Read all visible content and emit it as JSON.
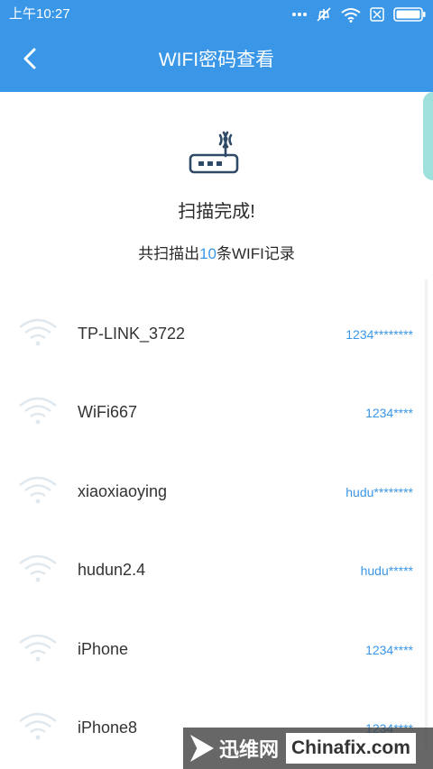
{
  "statusbar": {
    "time": "上午10:27",
    "icons": [
      "more-icon",
      "mute-icon",
      "wifi-signal-icon",
      "sim-icon",
      "battery-icon"
    ]
  },
  "header": {
    "title": "WIFI密码查看",
    "back_icon": "chevron-left-icon"
  },
  "scan": {
    "status": "扫描完成!",
    "summary_prefix": "共扫描出",
    "count": "10",
    "summary_suffix": "条WIFI记录"
  },
  "wifi_list": [
    {
      "ssid": "TP-LINK_3722",
      "password": "1234********"
    },
    {
      "ssid": "WiFi667",
      "password": "1234****"
    },
    {
      "ssid": "xiaoxiaoying",
      "password": "hudu********"
    },
    {
      "ssid": "hudun2.4",
      "password": "hudu*****"
    },
    {
      "ssid": "iPhone",
      "password": "1234****"
    },
    {
      "ssid": "iPhone8",
      "password": "1234****"
    }
  ],
  "watermark": {
    "brand": "迅维网",
    "site": "Chinafix.com"
  },
  "colors": {
    "primary": "#3a97e8",
    "text": "#2b2b2b",
    "wifi_icon": "#dfe8ee",
    "accent_teal": "#7ed6cf"
  }
}
